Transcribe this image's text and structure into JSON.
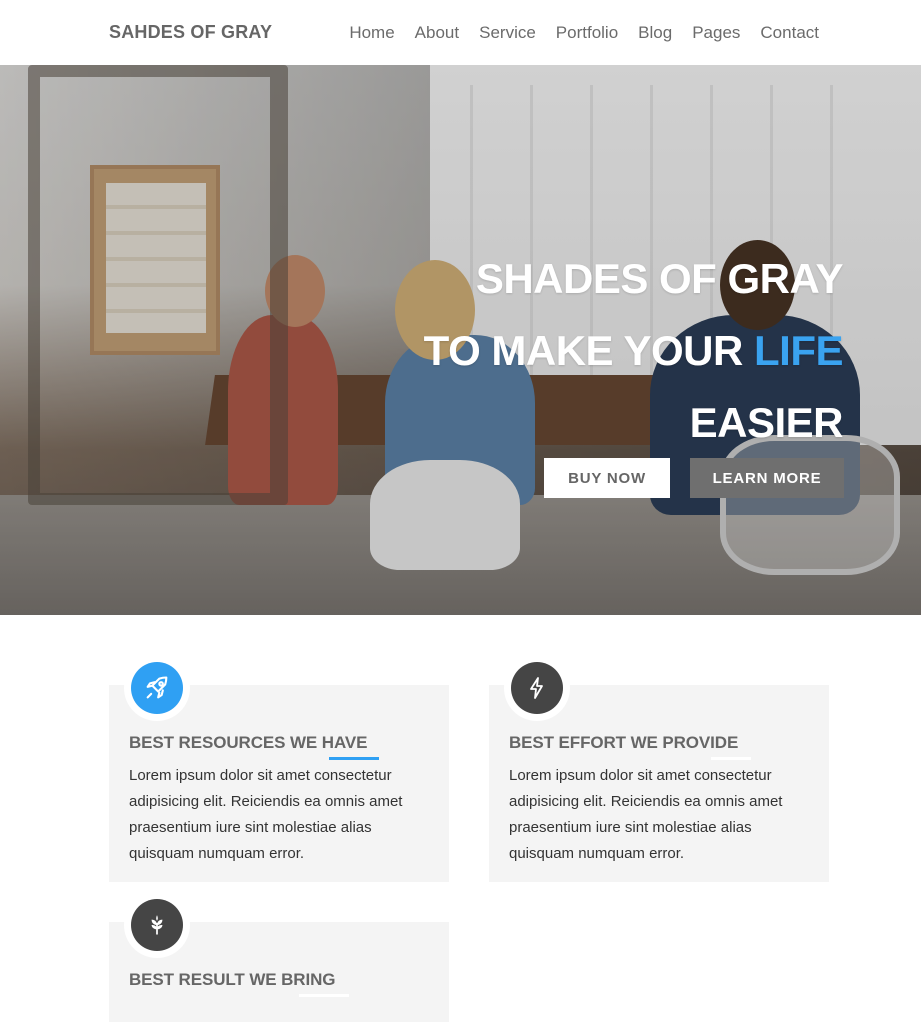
{
  "header": {
    "brand": "SAHDES OF GRAY",
    "nav": [
      "Home",
      "About",
      "Service",
      "Portfolio",
      "Blog",
      "Pages",
      "Contact"
    ]
  },
  "hero": {
    "line1": "SHADES OF GRAY",
    "line2_prefix": "TO MAKE YOUR ",
    "line2_accent": "LIFE",
    "line3": "EASIER",
    "buy_label": "BUY NOW",
    "learn_label": "LEARN MORE",
    "accent_color": "#3aa3f0"
  },
  "features": [
    {
      "icon": "rocket-icon",
      "title": "BEST RESOURCES WE HAVE",
      "body": "Lorem ipsum dolor sit amet consectetur adipisicing elit. Reiciendis ea omnis amet praesentium iure sint molestiae alias quisquam numquam error."
    },
    {
      "icon": "lightning-icon",
      "title": "BEST EFFORT WE PROVIDE",
      "body": "Lorem ipsum dolor sit amet consectetur adipisicing elit. Reiciendis ea omnis amet praesentium iure sint molestiae alias quisquam numquam error."
    },
    {
      "icon": "leaf-icon",
      "title": "BEST RESULT WE BRING",
      "body": ""
    }
  ],
  "colors": {
    "accent": "#2fa0f3",
    "dark_icon": "#454545",
    "card_bg": "#f4f4f4"
  }
}
